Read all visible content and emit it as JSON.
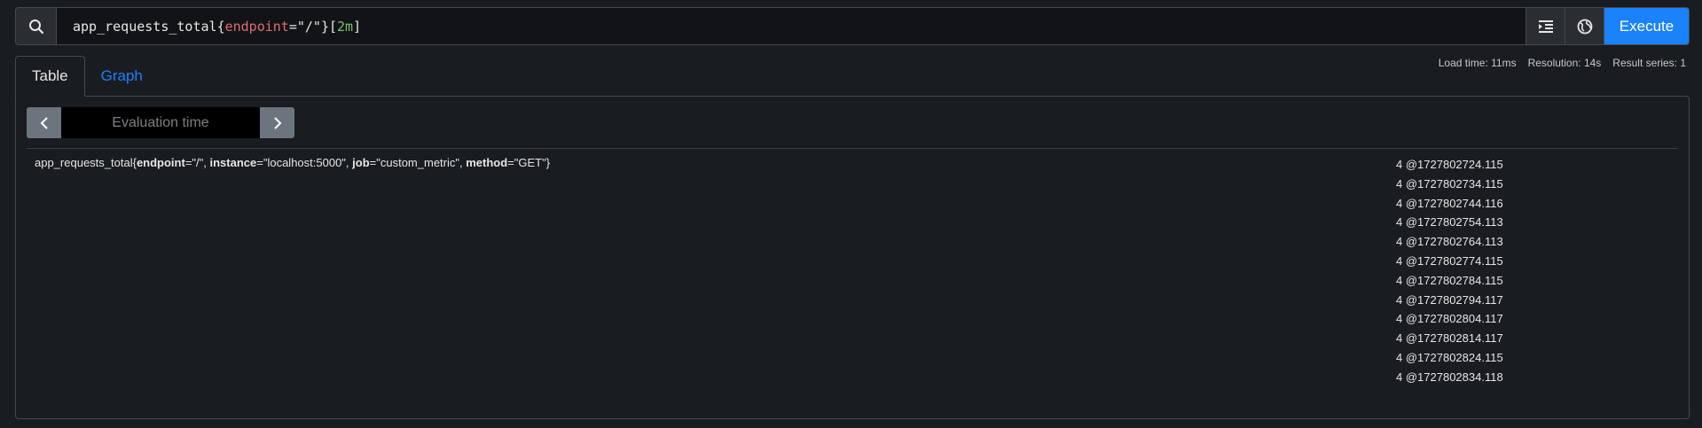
{
  "query": {
    "metric": "app_requests_total",
    "label_name": "endpoint",
    "label_value": "\"/\"",
    "range": "2m",
    "execute_label": "Execute"
  },
  "stats": {
    "load_time": "Load time: 11ms",
    "resolution": "Resolution: 14s",
    "result_series": "Result series: 1"
  },
  "tabs": [
    {
      "label": "Table",
      "active": true
    },
    {
      "label": "Graph",
      "active": false
    }
  ],
  "eval": {
    "placeholder": "Evaluation time"
  },
  "result": {
    "metric": "app_requests_total",
    "labels": [
      {
        "name": "endpoint",
        "value": "\"/\""
      },
      {
        "name": "instance",
        "value": "\"localhost:5000\""
      },
      {
        "name": "job",
        "value": "\"custom_metric\""
      },
      {
        "name": "method",
        "value": "\"GET\""
      }
    ],
    "values": [
      "4 @1727802724.115",
      "4 @1727802734.115",
      "4 @1727802744.116",
      "4 @1727802754.113",
      "4 @1727802764.113",
      "4 @1727802774.115",
      "4 @1727802784.115",
      "4 @1727802794.117",
      "4 @1727802804.117",
      "4 @1727802814.117",
      "4 @1727802824.115",
      "4 @1727802834.118"
    ]
  },
  "icons": [
    "search-icon",
    "format-icon",
    "globe-icon",
    "chevron-left-icon",
    "chevron-right-icon"
  ]
}
